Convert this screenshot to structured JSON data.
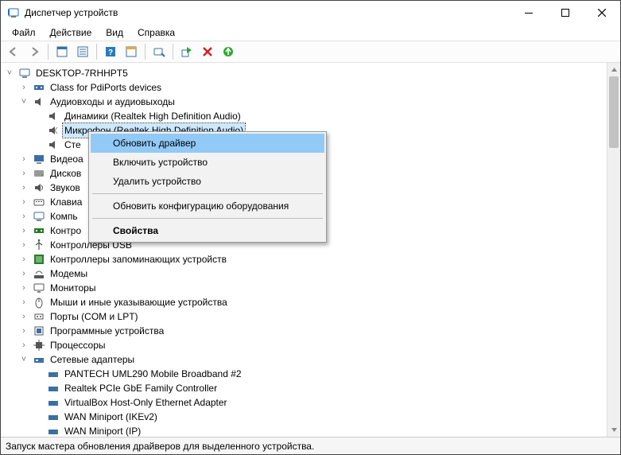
{
  "window": {
    "title": "Диспетчер устройств"
  },
  "menu": {
    "file": "Файл",
    "action": "Действие",
    "view": "Вид",
    "help": "Справка"
  },
  "tree": {
    "root": "DESKTOP-7RHHPT5",
    "pdiports": "Class for PdiPorts devices",
    "audio": "Аудиовходы и аудиовыходы",
    "audio_speakers": "Динамики (Realtek High Definition Audio)",
    "audio_mic": "Микрофон (Realtek High Definition Audio)",
    "audio_ste": "Сте",
    "video": "Видеоа",
    "disk": "Дисков",
    "sound": "Звуков",
    "keyboard": "Клавиа",
    "computer": "Компь",
    "controllers": "Контро",
    "usb": "Контроллеры USB",
    "storage_ctrl": "Контроллеры запоминающих устройств",
    "modems": "Модемы",
    "monitors": "Мониторы",
    "mice": "Мыши и иные указывающие устройства",
    "ports": "Порты (COM и LPT)",
    "software_dev": "Программные устройства",
    "cpu": "Процессоры",
    "net": "Сетевые адаптеры",
    "net_pantech": "PANTECH UML290 Mobile Broadband #2",
    "net_realtek": "Realtek PCIe GbE Family Controller",
    "net_vbox": "VirtualBox Host-Only Ethernet Adapter",
    "net_wan_ikev2": "WAN Miniport (IKEv2)",
    "net_wan_ip": "WAN Miniport (IP)"
  },
  "context_menu": {
    "update_driver": "Обновить драйвер",
    "enable": "Включить устройство",
    "uninstall": "Удалить устройство",
    "scan_hw": "Обновить конфигурацию оборудования",
    "properties": "Свойства"
  },
  "statusbar": {
    "text": "Запуск мастера обновления драйверов для выделенного устройства."
  }
}
